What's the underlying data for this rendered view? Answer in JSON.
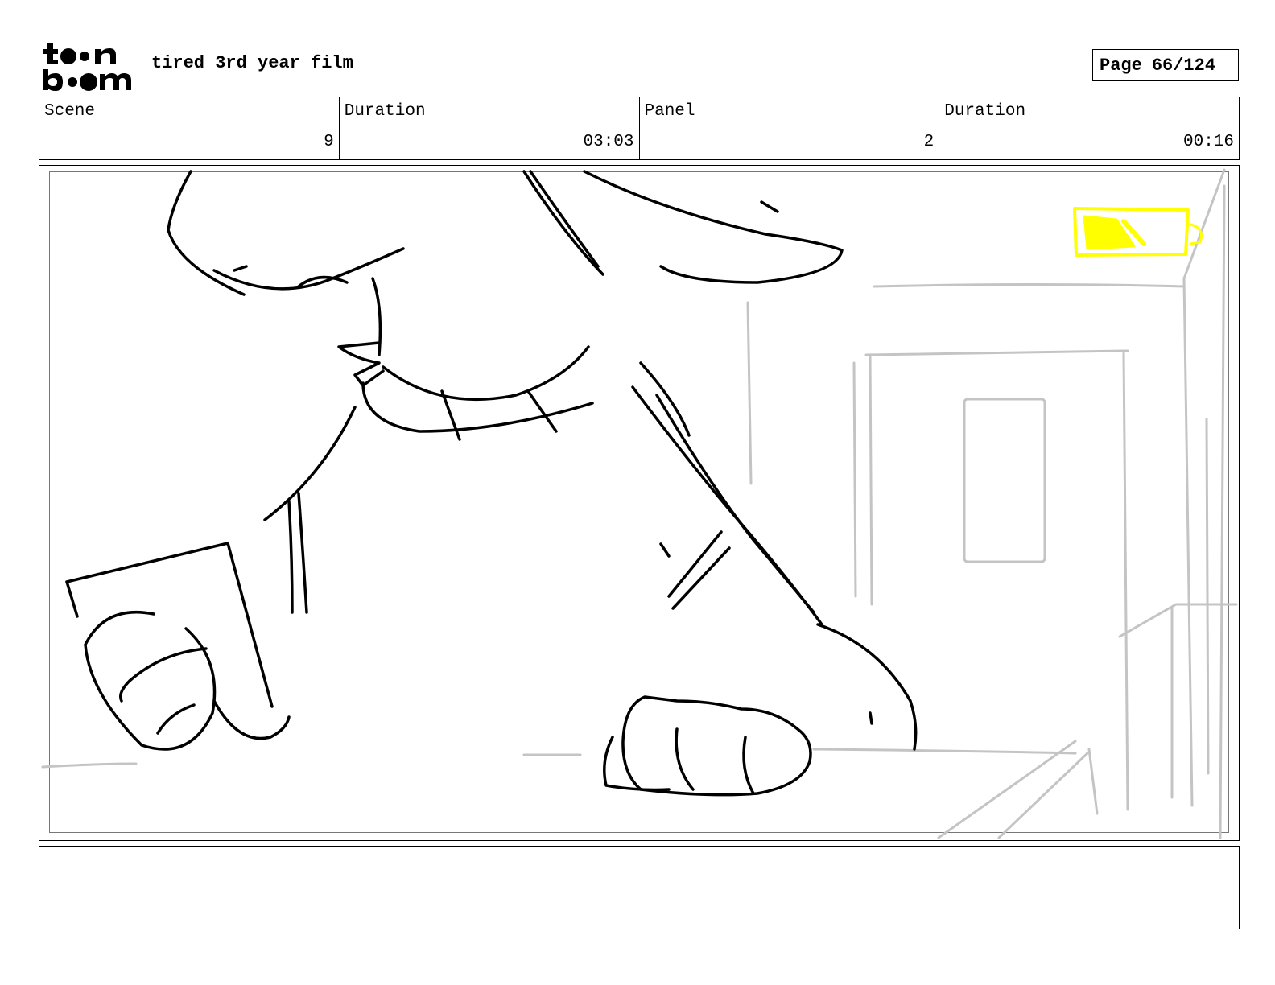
{
  "header": {
    "logo_text": "toon boom",
    "project_title": "tired 3rd year film",
    "page_label": "Page",
    "page_number": "66/124"
  },
  "info": {
    "scene_label": "Scene",
    "scene_value": "9",
    "scene_duration_label": "Duration",
    "scene_duration_value": "03:03",
    "panel_label": "Panel",
    "panel_value": "2",
    "panel_duration_label": "Duration",
    "panel_duration_value": "00:16"
  },
  "colors": {
    "sketch_line": "#000000",
    "background_line": "#c4c4c4",
    "highlight": "#ffff00"
  },
  "notes": {
    "text": ""
  }
}
